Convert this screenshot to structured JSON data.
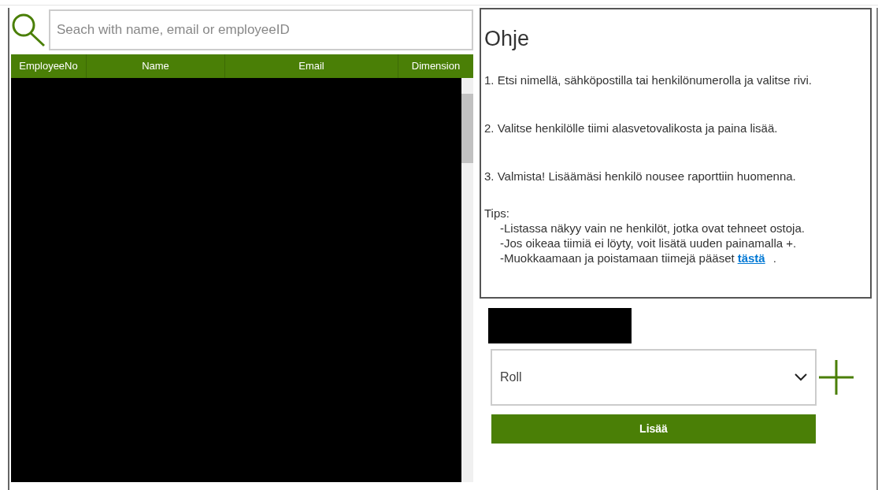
{
  "search": {
    "placeholder": "Seach with name, email or employeeID"
  },
  "table": {
    "columns": [
      "EmployeeNo",
      "Name",
      "Email",
      "Dimension"
    ]
  },
  "help": {
    "title": "Ohje",
    "steps": [
      "1. Etsi nimellä, sähköpostilla tai henkilönumerolla ja valitse rivi.",
      "2. Valitse henkilölle tiimi alasvetovalikosta ja paina lisää.",
      "3. Valmista! Lisäämäsi henkilö nousee raporttiin huomenna."
    ],
    "tips_label": "Tips:",
    "tips": [
      "-Listassa näkyy vain ne henkilöt, jotka ovat tehneet ostoja.",
      "-Jos oikeaa tiimiä ei löyty, voit lisätä uuden painamalla +."
    ],
    "last_tip": {
      "text": "-Muokkaamaan ja poistamaan tiimejä pääset",
      "link": "tästä",
      "end": "."
    }
  },
  "team_select": {
    "value": "Roll"
  },
  "add_button": "Lisää"
}
